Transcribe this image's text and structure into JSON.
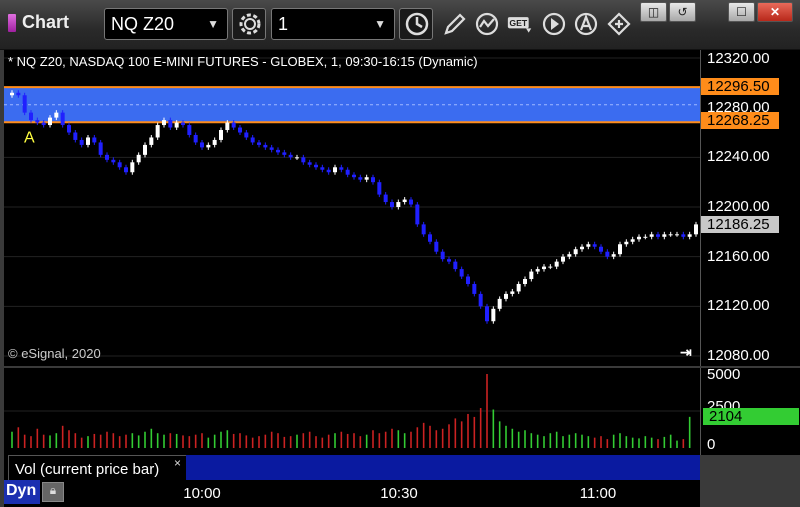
{
  "window": {
    "title": "Chart",
    "symbol": "NQ Z20",
    "interval": "1",
    "get_button_label": "GET",
    "controls": [
      "restore-icon",
      "maximize-icon",
      "close-icon"
    ]
  },
  "toolbar_icons": [
    "gear-icon",
    "clock-icon",
    "pencil-icon",
    "study-icon",
    "get-data-icon",
    "play-icon",
    "alert-icon",
    "link-icon"
  ],
  "chart": {
    "header": "* NQ Z20, NASDAQ 100 E-MINI FUTURES - GLOBEX, 1, 09:30-16:15 (Dynamic)",
    "copyright": "© eSignal, 2020",
    "annotation": "A",
    "price_axis_labels": [
      "12320.00",
      "12280.00",
      "12240.00",
      "12200.00",
      "12160.00",
      "12120.00",
      "12080.00"
    ],
    "price_tags": {
      "upper_line": "12296.50",
      "lower_line": "12268.25",
      "last_price": "12186.25"
    },
    "volume_axis_labels": [
      "5000",
      "2500",
      "0"
    ],
    "volume_tag": "2104",
    "volume_study_label": "Vol (current price bar)",
    "volume_close": "×",
    "time_labels": [
      "10:00",
      "10:30",
      "11:00"
    ],
    "interval_mode": "Dyn",
    "colors": {
      "up_candle": "#ffffff",
      "down_candle": "#2020ff",
      "zone_fill": "#3b6cf0",
      "zone_border": "#ff8c1a",
      "vol_up": "#33cc33",
      "vol_down": "#cc2222"
    }
  },
  "chart_data": {
    "type": "candlestick",
    "title": "NQ Z20, NASDAQ 100 E-MINI FUTURES - GLOBEX, 1, 09:30-16:15 (Dynamic)",
    "ylim": [
      12080,
      12320
    ],
    "zone": [
      12268.25,
      12296.5
    ],
    "last": 12186.25,
    "close": [
      12292,
      12290,
      12276,
      12270,
      12268,
      12266,
      12272,
      12276,
      12266,
      12260,
      12254,
      12250,
      12256,
      12252,
      12242,
      12238,
      12236,
      12232,
      12228,
      12236,
      12242,
      12250,
      12256,
      12266,
      12270,
      12264,
      12268,
      12266,
      12258,
      12252,
      12248,
      12250,
      12254,
      12262,
      12268,
      12264,
      12260,
      12256,
      12252,
      12250,
      12248,
      12246,
      12244,
      12242,
      12240,
      12240,
      12236,
      12234,
      12232,
      12230,
      12228,
      12232,
      12230,
      12226,
      12224,
      12222,
      12224,
      12220,
      12210,
      12204,
      12200,
      12204,
      12206,
      12202,
      12186,
      12178,
      12172,
      12164,
      12158,
      12156,
      12150,
      12144,
      12138,
      12130,
      12120,
      12108,
      12118,
      12126,
      12130,
      12132,
      12138,
      12142,
      12148,
      12150,
      12152,
      12152,
      12156,
      12160,
      12162,
      12166,
      12168,
      12170,
      12168,
      12164,
      12160,
      12162,
      12170,
      12172,
      12174,
      12176,
      12176,
      12178,
      12176,
      12178,
      12178,
      12178,
      12176,
      12178,
      12186
    ],
    "volume": [
      1100,
      1400,
      900,
      800,
      1300,
      900,
      850,
      1000,
      1500,
      1200,
      1000,
      700,
      800,
      950,
      900,
      1100,
      1000,
      800,
      900,
      1000,
      850,
      1100,
      1300,
      1000,
      900,
      1000,
      950,
      850,
      800,
      900,
      1000,
      700,
      900,
      1100,
      1200,
      950,
      1000,
      850,
      700,
      800,
      900,
      1100,
      1000,
      750,
      800,
      900,
      1000,
      1100,
      800,
      700,
      900,
      1000,
      1100,
      950,
      1000,
      800,
      900,
      1200,
      1000,
      1100,
      1300,
      1200,
      1000,
      1100,
      1400,
      1700,
      1500,
      1200,
      1300,
      1600,
      2000,
      1800,
      2300,
      2100,
      2700,
      5000,
      2600,
      1800,
      1500,
      1300,
      1100,
      1200,
      1000,
      900,
      800,
      1000,
      1100,
      800,
      900,
      1000,
      900,
      800,
      700,
      800,
      600,
      900,
      1000,
      800,
      700,
      650,
      800,
      700,
      600,
      750,
      900,
      500,
      600,
      2104
    ]
  }
}
